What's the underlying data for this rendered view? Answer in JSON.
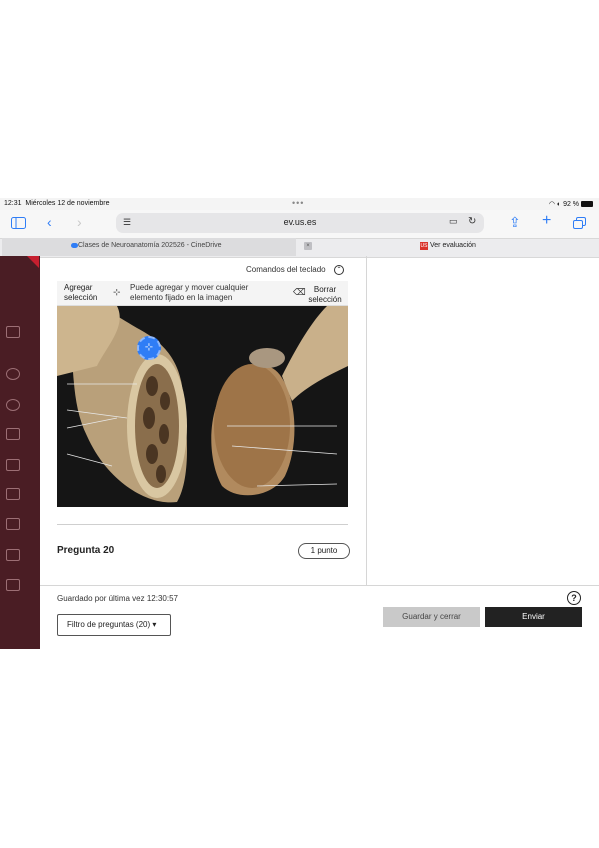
{
  "status": {
    "time": "12:31",
    "date": "Miércoles 12 de noviembre",
    "battery": "92 %"
  },
  "browser": {
    "url": "ev.us.es",
    "tabs": [
      {
        "label": "Clases de Neuroanatomía 202526 - CineDrive"
      },
      {
        "label": "Ver evaluación"
      }
    ],
    "tab2_favicon": "US"
  },
  "content": {
    "keyboard_commands": "Comandos del teclado",
    "add_selection": "Agregar selección",
    "hint": "Puede agregar y mover cualquier elemento fijado en la imagen",
    "clear_selection": "Borrar selección",
    "question_title": "Pregunta 20",
    "points": "1 punto"
  },
  "footer": {
    "saved_text": "Guardado por última vez 12:30:57",
    "filter_label": "Filtro de preguntas (20)",
    "save_close": "Guardar y cerrar",
    "send": "Enviar"
  },
  "icons": [
    "sidebar-icon",
    "back-icon",
    "forward-icon",
    "reader-icon",
    "translate-icon",
    "reload-icon",
    "share-icon",
    "new-tab-icon",
    "tabs-icon",
    "keyboard-icon",
    "pin-icon",
    "eraser-icon",
    "help-icon",
    "caret-down-icon"
  ],
  "colors": {
    "accent": "#2f7df6",
    "rail": "#4a1d24",
    "send_button": "#222222",
    "bookmark": "#c61f2f"
  }
}
